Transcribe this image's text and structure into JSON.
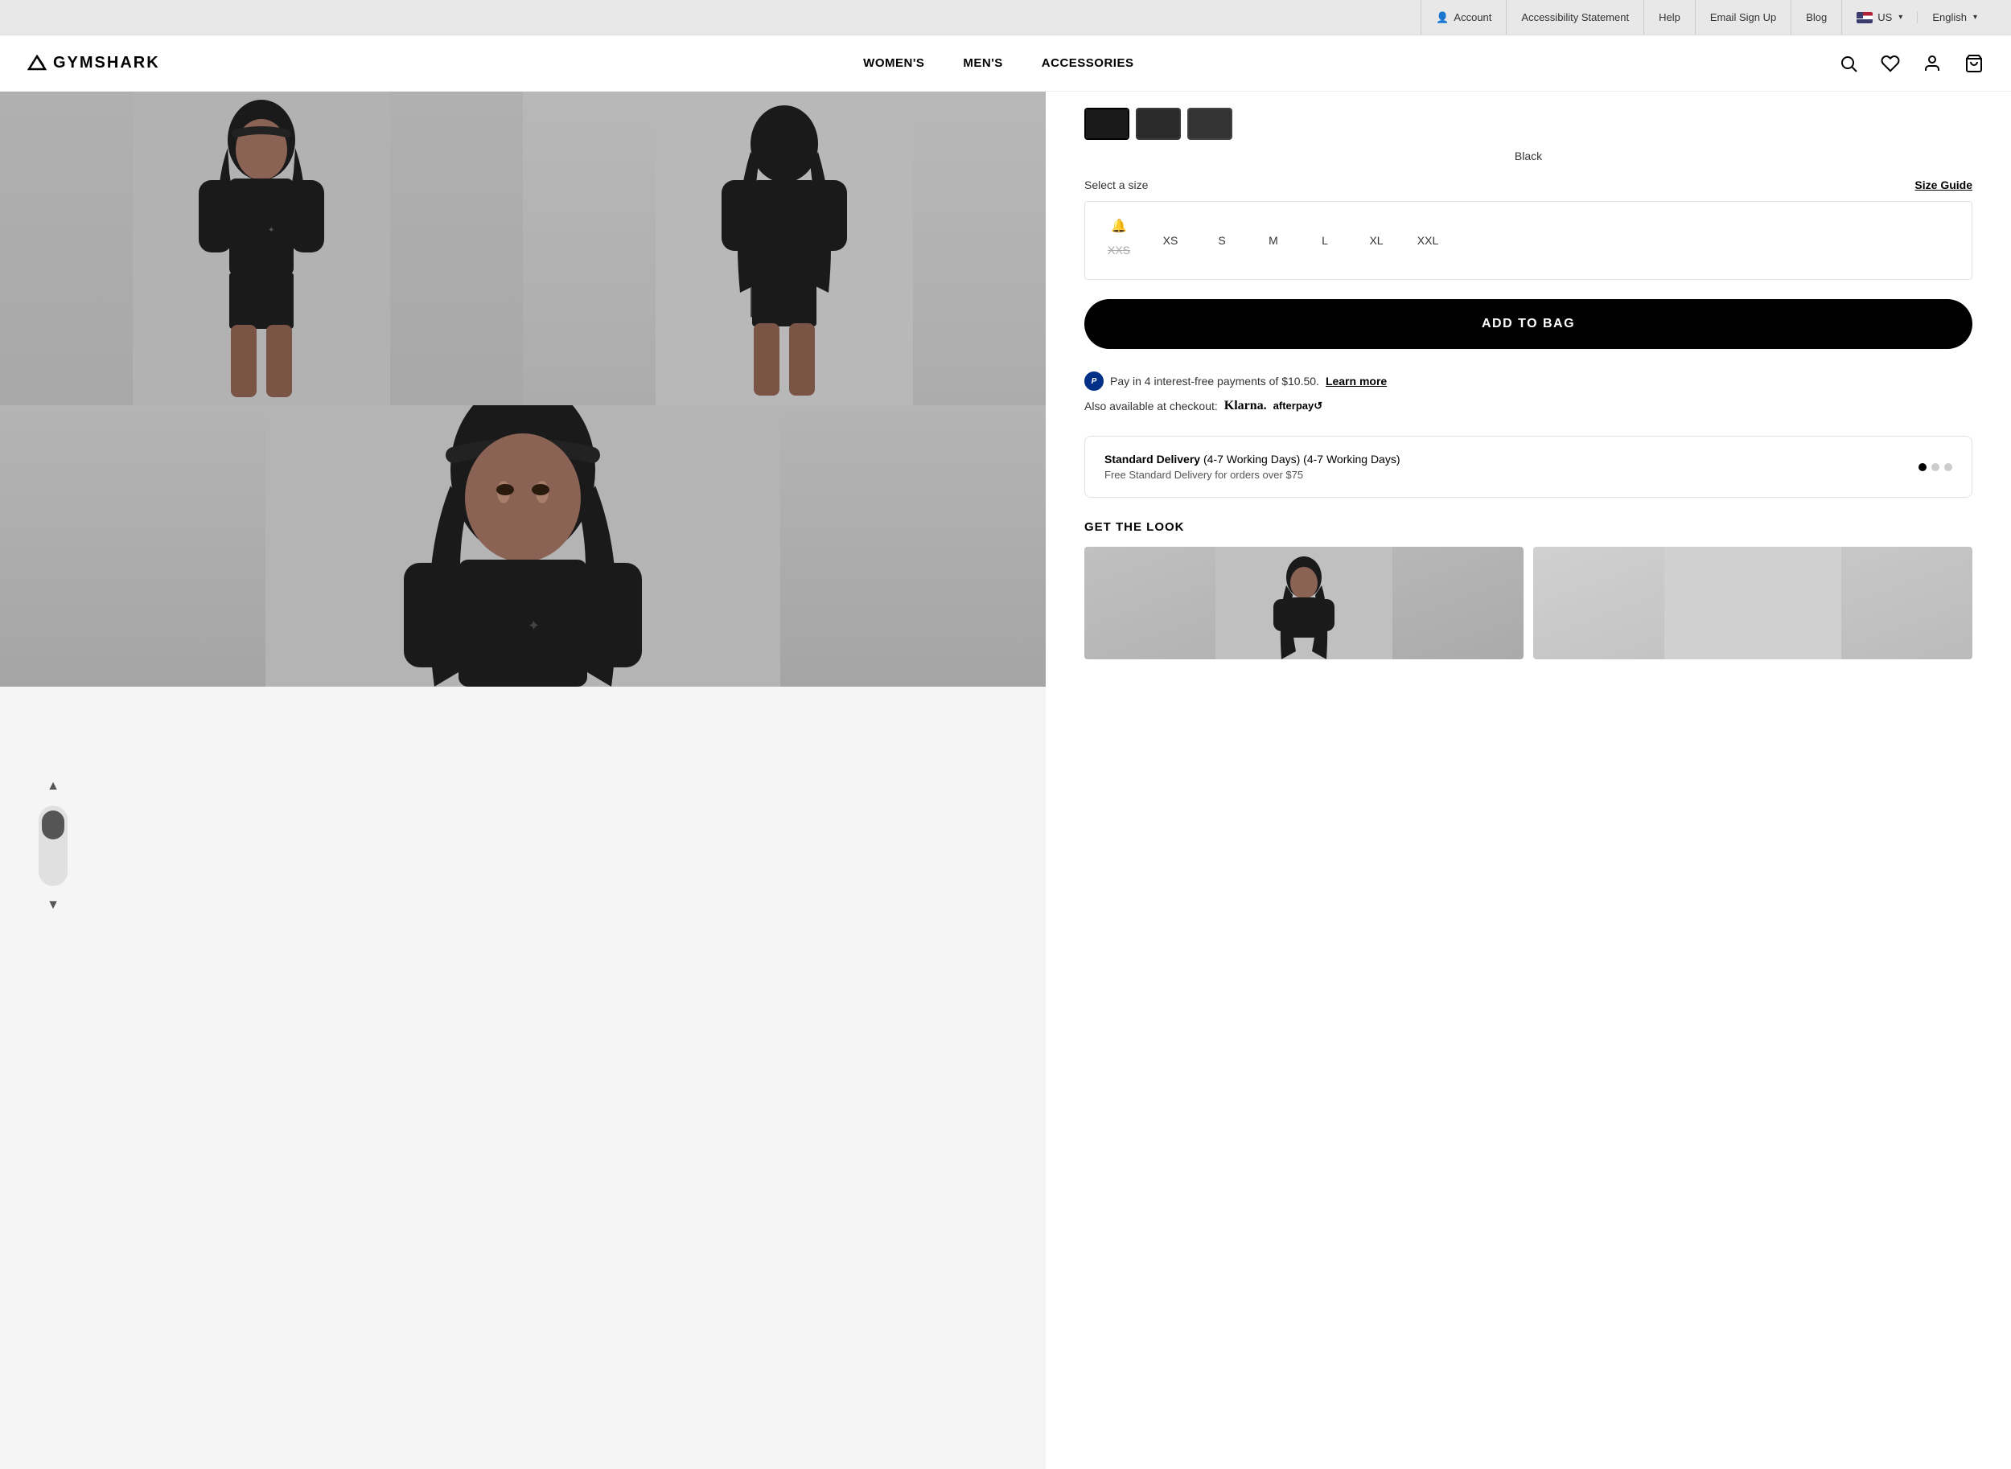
{
  "utility_bar": {
    "account_label": "Account",
    "accessibility_label": "Accessibility Statement",
    "help_label": "Help",
    "email_signup_label": "Email Sign Up",
    "blog_label": "Blog",
    "country": "US",
    "language": "English"
  },
  "header": {
    "logo_text": "GYMSHARK",
    "nav": [
      {
        "label": "WOMEN'S",
        "id": "womens"
      },
      {
        "label": "MEN'S",
        "id": "mens"
      },
      {
        "label": "ACCESSORIES",
        "id": "accessories"
      }
    ]
  },
  "product": {
    "color": {
      "current_label": "Black",
      "thumbnails": [
        {
          "label": "Black selected",
          "selected": true
        },
        {
          "label": "Black variant 2",
          "selected": false
        },
        {
          "label": "Black variant 3",
          "selected": false
        }
      ]
    },
    "size_selector": {
      "label": "Select a size",
      "guide_label": "Size Guide",
      "sizes": [
        {
          "label": "XXS",
          "bell": true,
          "disabled": true,
          "selected": false
        },
        {
          "label": "XS",
          "bell": false,
          "disabled": false,
          "selected": false
        },
        {
          "label": "S",
          "bell": false,
          "disabled": false,
          "selected": false
        },
        {
          "label": "M",
          "bell": false,
          "disabled": false,
          "selected": false
        },
        {
          "label": "L",
          "bell": false,
          "disabled": false,
          "selected": false
        },
        {
          "label": "XL",
          "bell": false,
          "disabled": false,
          "selected": false
        },
        {
          "label": "XXL",
          "bell": false,
          "disabled": false,
          "selected": false
        }
      ]
    },
    "add_to_bag_label": "ADD TO BAG",
    "payment": {
      "paypal_text": "Pay in 4 interest-free payments of $10.50.",
      "paypal_link": "Learn more",
      "checkout_prefix": "Also available at checkout:",
      "klarna": "Klarna.",
      "afterpay": "afterpay↺"
    },
    "delivery": {
      "title": "Standard Delivery",
      "days": "(4-7 Working Days)",
      "subtitle": "Free Standard Delivery for orders over $75",
      "dots": [
        true,
        false,
        false
      ]
    },
    "get_the_look": {
      "title": "GET THE LOOK"
    }
  }
}
